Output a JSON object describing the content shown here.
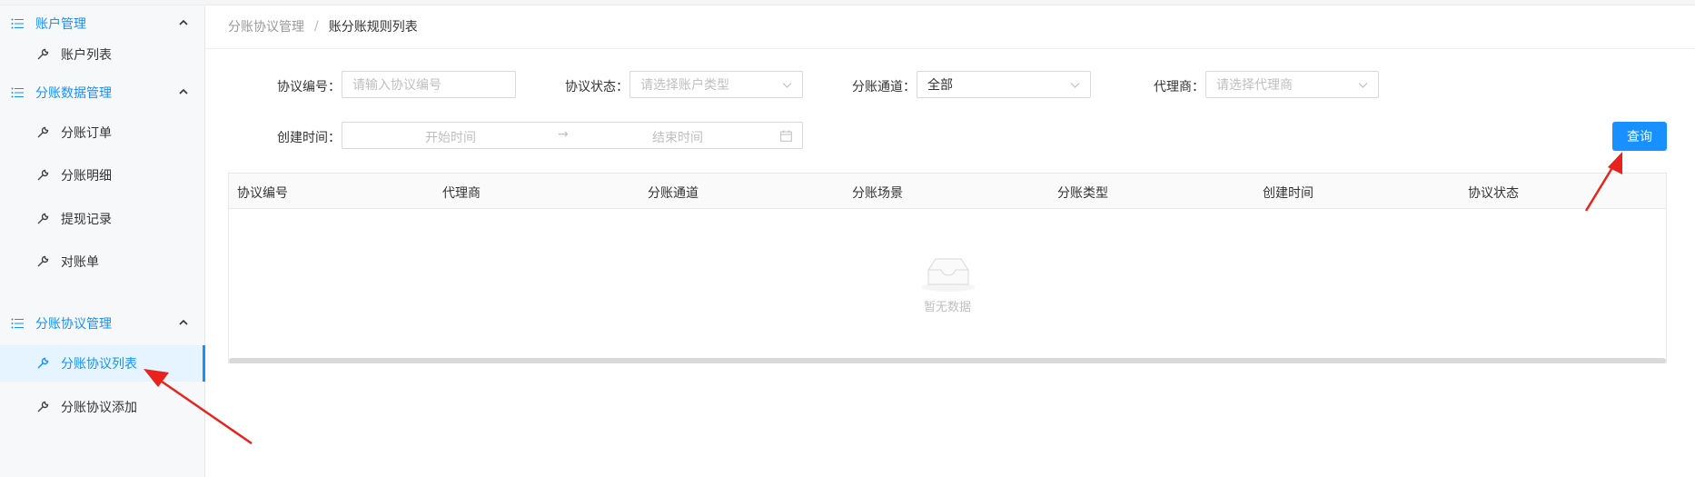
{
  "sidebar": {
    "groups": [
      {
        "title": "账户管理",
        "items": [
          {
            "label": "账户列表"
          }
        ]
      },
      {
        "title": "分账数据管理",
        "items": [
          {
            "label": "分账订单"
          },
          {
            "label": "分账明细"
          },
          {
            "label": "提现记录"
          },
          {
            "label": "对账单"
          }
        ]
      },
      {
        "title": "分账协议管理",
        "items": [
          {
            "label": "分账协议列表",
            "active": true
          },
          {
            "label": "分账协议添加"
          }
        ]
      }
    ]
  },
  "breadcrumb": {
    "parent": "分账协议管理",
    "separator": "/",
    "current": "账分账规则列表"
  },
  "filters": {
    "agreement_no": {
      "label": "协议编号：",
      "placeholder": "请输入协议编号"
    },
    "agreement_status": {
      "label": "协议状态：",
      "placeholder": "请选择账户类型"
    },
    "channel": {
      "label": "分账通道：",
      "value": "全部"
    },
    "agent": {
      "label": "代理商：",
      "placeholder": "请选择代理商"
    },
    "created_time": {
      "label": "创建时间：",
      "start_placeholder": "开始时间",
      "arrow": "→",
      "end_placeholder": "结束时间"
    }
  },
  "query_button": "查询",
  "table": {
    "columns": [
      "协议编号",
      "代理商",
      "分账通道",
      "分账场景",
      "分账类型",
      "创建时间",
      "协议状态"
    ],
    "empty_text": "暂无数据"
  },
  "icons": {
    "group": "list-icon",
    "item": "wrench-icon",
    "caret": "caret-up-icon",
    "select": "chevron-down-icon",
    "calendar": "calendar-icon",
    "empty": "empty-inbox-icon"
  },
  "colors": {
    "accent": "#1890ff",
    "annotation": "#e8231d",
    "active_bg": "#e6f4ff"
  }
}
